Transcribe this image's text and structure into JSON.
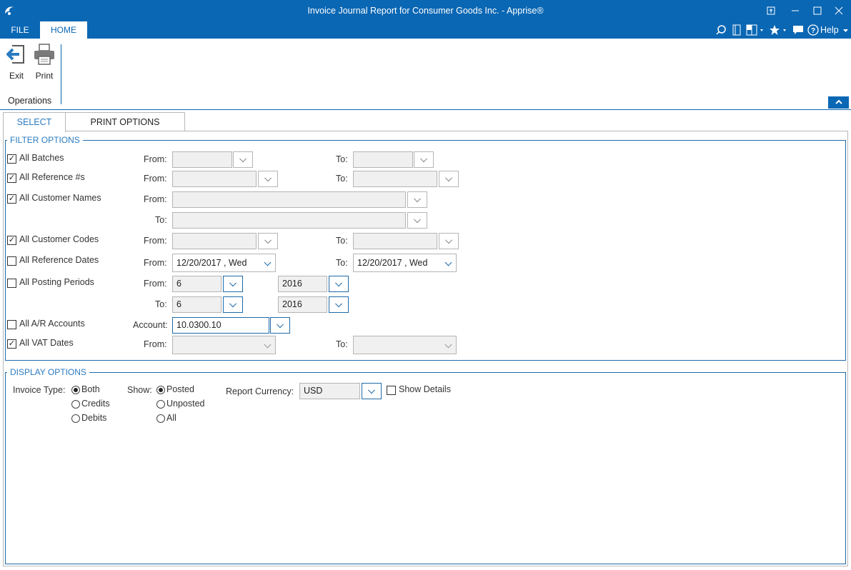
{
  "window": {
    "title": "Invoice Journal Report for Consumer Goods Inc. - Apprise®",
    "controls": {
      "restore": "⧉",
      "minimize": "—",
      "maximize": "☐",
      "close": "✕"
    }
  },
  "ribbon": {
    "tabs": [
      {
        "label": "FILE"
      },
      {
        "label": "HOME"
      }
    ],
    "help_label": "Help",
    "buttons": {
      "exit": "Exit",
      "print": "Print"
    },
    "group_label": "Operations"
  },
  "page_tabs": [
    {
      "label": "SELECT"
    },
    {
      "label": "PRINT OPTIONS"
    }
  ],
  "filter": {
    "title": "FILTER OPTIONS",
    "from": "From:",
    "to": "To:",
    "account": "Account:",
    "rows": [
      {
        "label": "All Batches",
        "checked": "✓"
      },
      {
        "label": "All Reference #s",
        "checked": "✓"
      },
      {
        "label": "All Customer Names",
        "checked": "✓"
      },
      {
        "label": "All Customer Codes",
        "checked": "✓"
      },
      {
        "label": "All Reference Dates",
        "checked": ""
      },
      {
        "label": "All Posting Periods",
        "checked": ""
      },
      {
        "label": "All A/R Accounts",
        "checked": ""
      },
      {
        "label": "All VAT Dates",
        "checked": "✓"
      }
    ],
    "ref_date_from": "12/20/2017 , Wed",
    "ref_date_to": "12/20/2017 , Wed",
    "period_from": "6",
    "year_from": "2016",
    "period_to": "6",
    "year_to": "2016",
    "account_value": "10.0300.10"
  },
  "display": {
    "title": "DISPLAY OPTIONS",
    "invoice_type_label": "Invoice Type:",
    "invoice_types": [
      "Both",
      "Credits",
      "Debits"
    ],
    "show_label": "Show:",
    "show_options": [
      "Posted",
      "Unposted",
      "All"
    ],
    "currency_label": "Report Currency:",
    "currency_value": "USD",
    "show_details_label": "Show Details"
  },
  "colors": {
    "accent": "#0a67b4",
    "label_blue": "#2a7bbf"
  }
}
